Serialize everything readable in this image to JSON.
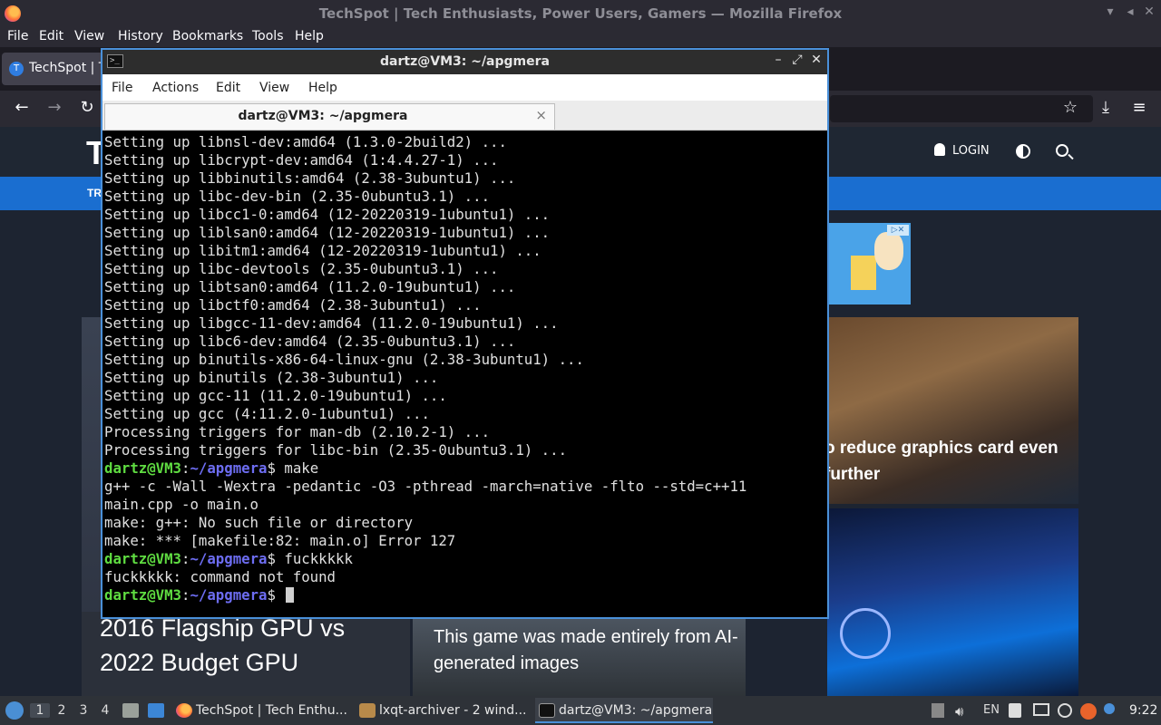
{
  "firefox": {
    "window_title": "TechSpot | Tech Enthusiasts, Power Users, Gamers — Mozilla Firefox",
    "menu": [
      "File",
      "Edit",
      "View",
      "History",
      "Bookmarks",
      "Tools",
      "Help"
    ],
    "tab_label": "TechSpot | Tech Enthusiasts",
    "tab_favicon": "T"
  },
  "website": {
    "logo_letter": "T",
    "login_label": "LOGIN",
    "nav_fragment": "TR",
    "headlines": {
      "right_top": "o reduce graphics card even further",
      "left_bottom": "2016 Flagship GPU vs 2022 Budget GPU",
      "middle_bottom": "This game was made entirely from AI-generated images"
    }
  },
  "terminal": {
    "window_title": "dartz@VM3: ~/apgmera",
    "menu": [
      "File",
      "Actions",
      "Edit",
      "View",
      "Help"
    ],
    "tab_title": "dartz@VM3: ~/apgmera",
    "tab_close": "×",
    "lines": [
      {
        "text": "Setting up libnsl-dev:amd64 (1.3.0-2build2) ..."
      },
      {
        "text": "Setting up libcrypt-dev:amd64 (1:4.4.27-1) ..."
      },
      {
        "text": "Setting up libbinutils:amd64 (2.38-3ubuntu1) ..."
      },
      {
        "text": "Setting up libc-dev-bin (2.35-0ubuntu3.1) ..."
      },
      {
        "text": "Setting up libcc1-0:amd64 (12-20220319-1ubuntu1) ..."
      },
      {
        "text": "Setting up liblsan0:amd64 (12-20220319-1ubuntu1) ..."
      },
      {
        "text": "Setting up libitm1:amd64 (12-20220319-1ubuntu1) ..."
      },
      {
        "text": "Setting up libc-devtools (2.35-0ubuntu3.1) ..."
      },
      {
        "text": "Setting up libtsan0:amd64 (11.2.0-19ubuntu1) ..."
      },
      {
        "text": "Setting up libctf0:amd64 (2.38-3ubuntu1) ..."
      },
      {
        "text": "Setting up libgcc-11-dev:amd64 (11.2.0-19ubuntu1) ..."
      },
      {
        "text": "Setting up libc6-dev:amd64 (2.35-0ubuntu3.1) ..."
      },
      {
        "text": "Setting up binutils-x86-64-linux-gnu (2.38-3ubuntu1) ..."
      },
      {
        "text": "Setting up binutils (2.38-3ubuntu1) ..."
      },
      {
        "text": "Setting up gcc-11 (11.2.0-19ubuntu1) ..."
      },
      {
        "text": "Setting up gcc (4:11.2.0-1ubuntu1) ..."
      },
      {
        "text": "Processing triggers for man-db (2.10.2-1) ..."
      },
      {
        "text": "Processing triggers for libc-bin (2.35-0ubuntu3.1) ..."
      },
      {
        "user": "dartz@VM3",
        "sep": ":",
        "path": "~/apgmera",
        "cmd": "$ make"
      },
      {
        "text": "g++ -c -Wall -Wextra -pedantic -O3 -pthread -march=native -flto --std=c++11"
      },
      {
        "text": "main.cpp -o main.o"
      },
      {
        "text": "make: g++: No such file or directory"
      },
      {
        "text": "make: *** [makefile:82: main.o] Error 127"
      },
      {
        "user": "dartz@VM3",
        "sep": ":",
        "path": "~/apgmera",
        "cmd": "$ fuckkkkk"
      },
      {
        "text": "fuckkkkk: command not found"
      },
      {
        "user": "dartz@VM3",
        "sep": ":",
        "path": "~/apgmera",
        "cmd": "$ ",
        "cursor": true
      }
    ],
    "colors": {
      "user": "#5fdc41",
      "path": "#6d6df2",
      "text": "#e0e0e0"
    }
  },
  "taskbar": {
    "workspaces": [
      "1",
      "2",
      "3",
      "4"
    ],
    "active_workspace": "1",
    "tasks": [
      {
        "label": "TechSpot | Tech Enthu...",
        "icon": "firefox-icon"
      },
      {
        "label": "lxqt-archiver - 2 wind...",
        "icon": "archiver-icon"
      },
      {
        "label": "dartz@VM3: ~/apgmera",
        "icon": "terminal-icon"
      }
    ],
    "keyboard_layout": "EN",
    "clock": "9:22"
  }
}
